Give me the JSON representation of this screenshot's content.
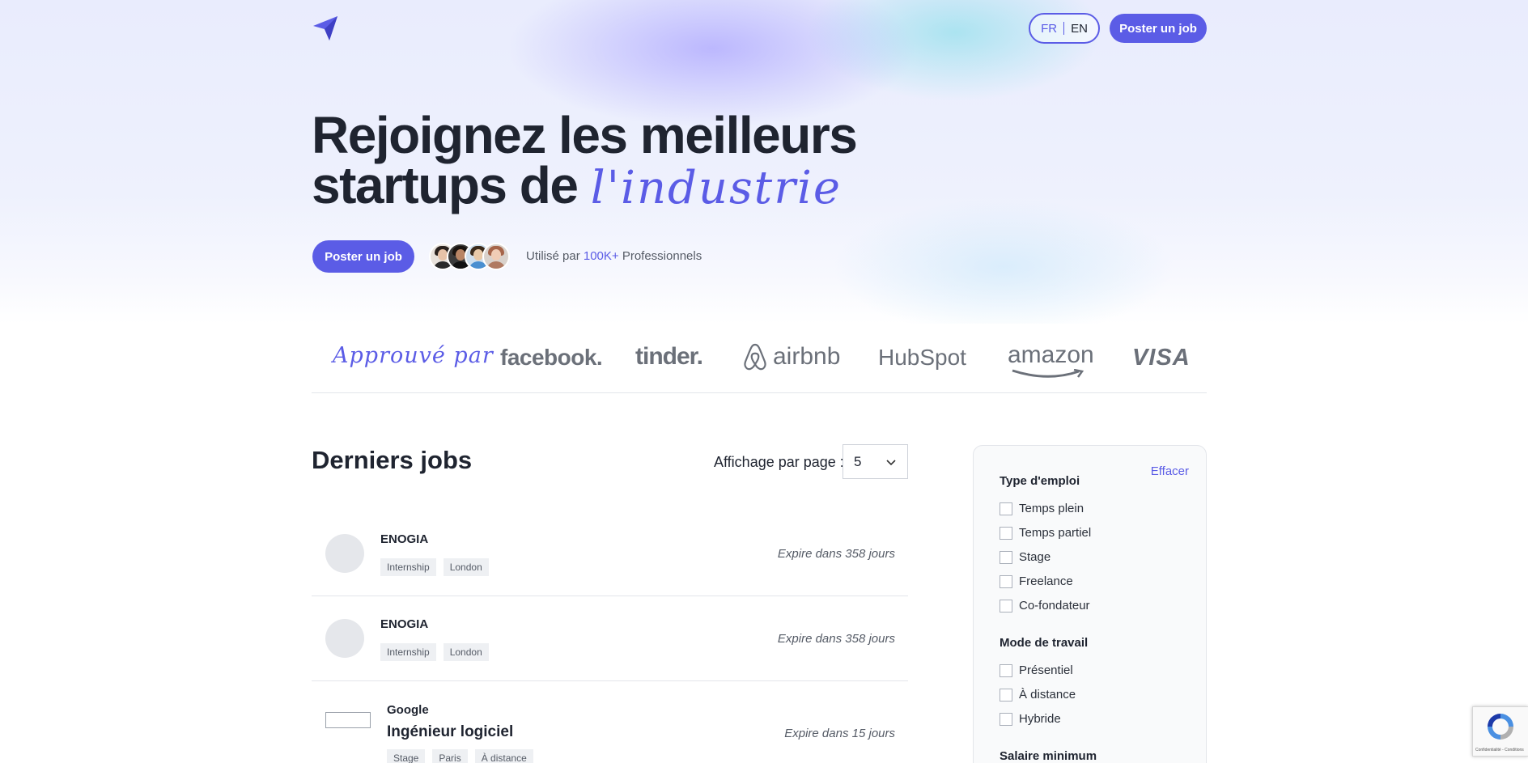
{
  "header": {
    "lang_fr": "FR",
    "lang_en": "EN",
    "post_job": "Poster un job"
  },
  "hero": {
    "title_line1": "Rejoignez les meilleurs",
    "title_line2": "startups de",
    "title_script": "l'industrie",
    "post_job": "Poster un job",
    "used_by_prefix": "Utilisé par",
    "used_by_count": "100K+",
    "used_by_suffix": "Professionnels"
  },
  "brands": {
    "approved": "Approuvé par",
    "items": [
      "facebook.",
      "tinder.",
      "airbnb",
      "HubSpot",
      "amazon",
      "VISA"
    ]
  },
  "jobs": {
    "title": "Derniers jobs",
    "per_page_label": "Affichage par page :",
    "per_page_value": "5",
    "rows": [
      {
        "company": "ENOGIA",
        "title": "",
        "tags": [
          "Internship",
          "London"
        ],
        "expires": "Expire dans 358 jours"
      },
      {
        "company": "ENOGIA",
        "title": "",
        "tags": [
          "Internship",
          "London"
        ],
        "expires": "Expire dans 358 jours"
      },
      {
        "company": "Google",
        "title": "Ingénieur logiciel",
        "tags": [
          "Stage",
          "Paris",
          "À distance"
        ],
        "expires": "Expire dans 15 jours"
      }
    ]
  },
  "filters": {
    "clear": "Effacer",
    "employment_type": {
      "heading": "Type d'emploi",
      "options": [
        "Temps plein",
        "Temps partiel",
        "Stage",
        "Freelance",
        "Co-fondateur"
      ]
    },
    "work_mode": {
      "heading": "Mode de travail",
      "options": [
        "Présentiel",
        "À distance",
        "Hybride"
      ]
    },
    "salary": {
      "heading": "Salaire minimum"
    }
  },
  "recaptcha": {
    "text": "Confidentialité - Conditions"
  },
  "colors": {
    "accent": "#5b5ce6",
    "text": "#1f2430",
    "muted": "#6b7079"
  }
}
